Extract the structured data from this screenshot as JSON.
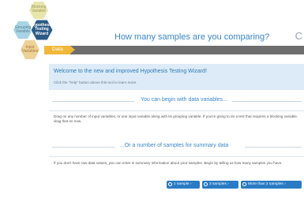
{
  "app": {
    "title": "How many samples are you comparing?"
  },
  "hexes": {
    "blocking": "Blocking Variable",
    "grouping": "Grouping Variable",
    "wizard": "Hypothesis Testing Wizard",
    "input": "Input Variables"
  },
  "tab": {
    "label": "Data"
  },
  "welcome": {
    "title": "Welcome to the new and improved Hypothesis Testing Wizard!",
    "subtitle": "Click the \"help\" button above this tool to learn more."
  },
  "section_variables": {
    "heading": "You can begin with data variables...",
    "text": "Drag on any number of input variables, or one input variable along with its grouping variable. If you're going to do a test that requires a blocking variable, drag that on now."
  },
  "section_summary": {
    "heading": "...Or a number of samples for summary data",
    "text": "If you don't have raw data values, you can enter in summary information about your samples. Begin by telling us how many samples you have."
  },
  "buttons": {
    "one": "1 sample ›",
    "two": "2 samples ›",
    "more": "More than 2 samples ›"
  },
  "colors": {
    "blocking_hex": "#e9e6ac",
    "grouping_hex": "#a9d4e3",
    "wizard_hex": "#2d5b86",
    "input_hex": "#eed198",
    "tab_accent": "#f0b83a",
    "primary_button": "#2a7bc4",
    "title_blue": "#3a86c8"
  },
  "icons": {
    "refresh": "refresh-icon"
  }
}
